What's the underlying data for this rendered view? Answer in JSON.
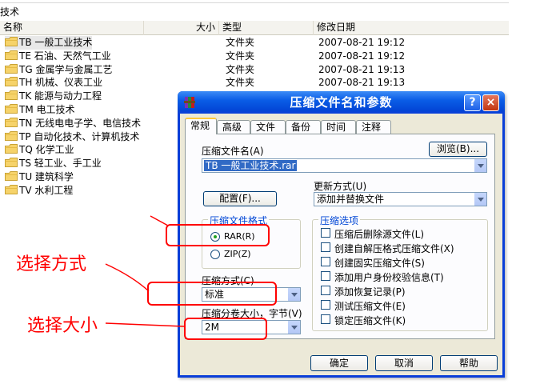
{
  "explorer": {
    "breadcrumb": "技术",
    "columns": {
      "name": "名称",
      "size": "大小",
      "type": "类型",
      "modified": "修改日期"
    },
    "rows": [
      {
        "name": "TB 一般工业技术",
        "type": "文件夹",
        "date": "2007-08-21 19:12",
        "selected": true
      },
      {
        "name": "TE 石油、天然气工业",
        "type": "文件夹",
        "date": "2007-08-21 19:12"
      },
      {
        "name": "TG 金属学与金属工艺",
        "type": "文件夹",
        "date": "2007-08-21 19:13"
      },
      {
        "name": "TH 机械、仪表工业",
        "type": "文件夹",
        "date": "2007-08-21 19:13"
      },
      {
        "name": "TK 能源与动力工程",
        "type": "",
        "date": ""
      },
      {
        "name": "TM 电工技术",
        "type": "",
        "date": ""
      },
      {
        "name": "TN 无线电电子学、电信技术",
        "type": "",
        "date": ""
      },
      {
        "name": "TP 自动化技术、计算机技术",
        "type": "",
        "date": ""
      },
      {
        "name": "TQ 化学工业",
        "type": "",
        "date": ""
      },
      {
        "name": "TS 轻工业、手工业",
        "type": "",
        "date": ""
      },
      {
        "name": "TU 建筑科学",
        "type": "",
        "date": ""
      },
      {
        "name": "TV 水利工程",
        "type": "",
        "date": ""
      }
    ]
  },
  "dialog": {
    "title": "压缩文件名和参数",
    "help_button": "?",
    "close_button": "×",
    "tabs": [
      "常规",
      "高级",
      "文件",
      "备份",
      "时间",
      "注释"
    ],
    "archive_name_label": "压缩文件名(A)",
    "archive_name_value": "TB 一般工业技术.rar",
    "browse_button": "浏览(B)...",
    "update_mode_label": "更新方式(U)",
    "update_mode_value": "添加并替换文件",
    "profiles_button": "配置(F)...",
    "format_group_title": "压缩文件格式",
    "format_rar": "RAR(R)",
    "format_zip": "ZIP(Z)",
    "format_selected": "RAR",
    "method_label": "压缩方式(C)",
    "method_value": "标准",
    "volume_label": "压缩分卷大小，字节(V)",
    "volume_value": "2M",
    "options_group_title": "压缩选项",
    "options": [
      "压缩后删除源文件(L)",
      "创建自解压格式压缩文件(X)",
      "创建固实压缩文件(S)",
      "添加用户身份校验信息(T)",
      "添加恢复记录(P)",
      "测试压缩文件(E)",
      "锁定压缩文件(K)"
    ],
    "ok_button": "确定",
    "cancel_button": "取消",
    "help_text_button": "帮助"
  },
  "annotations": {
    "choose_method": "选择方式",
    "choose_size": "选择大小",
    "color": "#ff0000"
  },
  "colors": {
    "titlebar": "#0a5de6",
    "dialog_bg": "#ece9d8",
    "selection": "#316ac5"
  }
}
